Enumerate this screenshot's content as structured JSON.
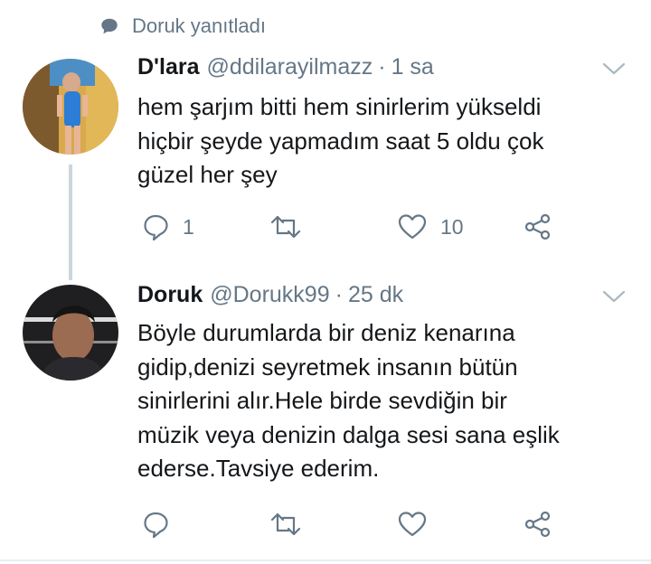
{
  "context": {
    "text": "Doruk yanıtladı",
    "icon": "speech-bubble-icon"
  },
  "tweets": [
    {
      "name": "D'lara",
      "handle": "@ddilarayilmazz",
      "separator": "·",
      "time": "1 sa",
      "lines": [
        "hem şarjım bitti hem sinirlerim yükseldi",
        "hiçbir şeyde yapmadım saat 5 oldu çok",
        "güzel her şey"
      ],
      "reply_count": "1",
      "retweet_count": "",
      "like_count": "10"
    },
    {
      "name": "Doruk",
      "handle": "@Dorukk99",
      "separator": "·",
      "time": "25 dk",
      "lines": [
        "Böyle durumlarda bir deniz kenarına",
        "gidip,denizi seyretmek insanın bütün",
        "sinirlerini alır.Hele birde sevdiğin bir",
        "müzik veya denizin dalga sesi sana eşlik",
        "ederse.Tavsiye ederim."
      ],
      "reply_count": "",
      "retweet_count": "",
      "like_count": ""
    }
  ],
  "colors": {
    "text": "#14171a",
    "muted": "#657786",
    "thread_line": "#ccd6dd",
    "divider": "#e6ecf0"
  }
}
